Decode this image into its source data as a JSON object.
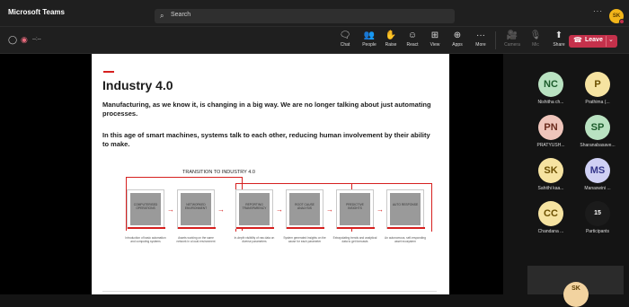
{
  "app": {
    "title": "Microsoft Teams",
    "search_placeholder": "Search",
    "more": "···",
    "user_initials": "SK"
  },
  "toolbar": {
    "timer": "--:--",
    "buttons": [
      {
        "label": "Chat",
        "icon": "chat-icon",
        "glyph": "🗨"
      },
      {
        "label": "People",
        "icon": "people-icon",
        "glyph": "👥"
      },
      {
        "label": "Raise",
        "icon": "raise-hand-icon",
        "glyph": "✋"
      },
      {
        "label": "React",
        "icon": "react-icon",
        "glyph": "☺"
      },
      {
        "label": "View",
        "icon": "view-icon",
        "glyph": "⊞"
      },
      {
        "label": "Apps",
        "icon": "apps-icon",
        "glyph": "⊕"
      },
      {
        "label": "More",
        "icon": "more-icon",
        "glyph": "···"
      },
      {
        "label": "Camera",
        "icon": "camera-off-icon",
        "glyph": "🎥"
      },
      {
        "label": "Mic",
        "icon": "mic-off-icon",
        "glyph": "🎙"
      },
      {
        "label": "Share",
        "icon": "share-icon",
        "glyph": "⬆"
      }
    ],
    "leave_label": "Leave"
  },
  "slide": {
    "title": "Industry 4.0",
    "para1": "Manufacturing, as we know it, is changing in a big way. We are no longer talking about just automating processes.",
    "para2": "In this age of smart machines, systems talk to each other, reducing human involvement by their ability to make.",
    "diagram_title": "TRANSITION TO INDUSTRY 4.0",
    "steps": [
      {
        "label": "COMPUTERISED OPERATIONS",
        "desc": "Introduction of basic automation and computing systems"
      },
      {
        "label": "NETWORKED ENVIRONMENT",
        "desc": "Assets working on the same network in a local environment"
      },
      {
        "label": "REPORTING TRANSPARENCY",
        "desc": "In-depth visibility of raw data on diverse parameters"
      },
      {
        "label": "ROOT CAUSE ANALYSIS",
        "desc": "System generated insights on the cause for each parameter"
      },
      {
        "label": "PREDICTIVE INSIGHTS",
        "desc": "Extrapolating trends and analytical data to get forecasts"
      },
      {
        "label": "AUTO RESPONSE",
        "desc": "An autonomous, self-responding asset ecosystem"
      }
    ]
  },
  "participants": [
    {
      "initials": "NC",
      "name": "Nishitha ch...",
      "color": "#b9e2c1",
      "text_color": "#1c5b2b"
    },
    {
      "initials": "P",
      "name": "Prathima (...",
      "color": "#f6e3a1",
      "text_color": "#6b4f00"
    },
    {
      "initials": "PN",
      "name": "PRATYUSH...",
      "color": "#efc5bb",
      "text_color": "#6a2a1c"
    },
    {
      "initials": "SP",
      "name": "Sharanabasave...",
      "color": "#b9e2c1",
      "text_color": "#1c5b2b"
    },
    {
      "initials": "SK",
      "name": "Sahithi kaa...",
      "color": "#f6e3a1",
      "text_color": "#6b4f00"
    },
    {
      "initials": "MS",
      "name": "Manaswini ...",
      "color": "#cfd0f4",
      "text_color": "#33358a"
    },
    {
      "initials": "CC",
      "name": "Chandana ...",
      "color": "#f6e3a1",
      "text_color": "#6b4f00"
    },
    {
      "initials": "15",
      "name": "Participants",
      "color": "#1b1b1b",
      "text_color": "#ffffff"
    }
  ],
  "local_video": {
    "initials": "SK"
  }
}
